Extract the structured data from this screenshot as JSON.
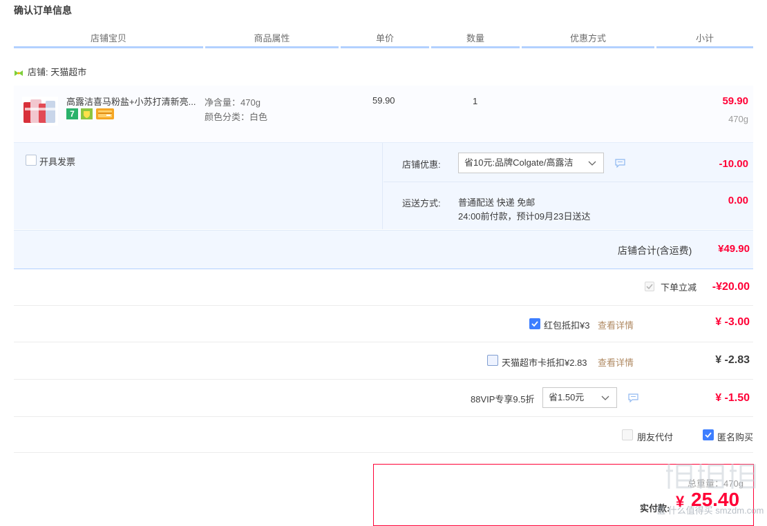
{
  "page_title": "确认订单信息",
  "columns": [
    "店铺宝贝",
    "商品属性",
    "单价",
    "数量",
    "优惠方式",
    "小计"
  ],
  "shop": {
    "label": "店铺: 天猫超市"
  },
  "item": {
    "name": "高露洁喜马粉盐+小苏打清新亮...",
    "attr_weight": "净含量：470g",
    "attr_color": "颜色分类：白色",
    "unit_price": "59.90",
    "quantity": "1",
    "subtotal": "59.90",
    "subtotal_note": "470g",
    "badge_7_label": "7"
  },
  "invoice": {
    "label": "开具发票",
    "checked": false
  },
  "shop_discount": {
    "label": "店铺优惠:",
    "selected": "省10元:品牌Colgate/高露洁",
    "amount": "-10.00"
  },
  "shipping": {
    "label": "运送方式:",
    "method": "普通配送 快递 免邮",
    "note": "24:00前付款，预计09月23日送达",
    "amount": "0.00"
  },
  "shop_total": {
    "label": "店铺合计(含运费)",
    "amount": "¥49.90"
  },
  "instant_discount": {
    "label": "下单立减",
    "amount": "-¥20.00",
    "checked": true
  },
  "red_packet": {
    "label": "红包抵扣¥3",
    "link": "查看详情",
    "amount": "¥ -3.00",
    "checked": true
  },
  "tmall_card": {
    "label": "天猫超市卡抵扣¥2.83",
    "link": "查看详情",
    "amount": "¥ -2.83",
    "checked": false
  },
  "vip": {
    "label": "88VIP专享9.5折",
    "selected": "省1.50元",
    "amount": "¥ -1.50"
  },
  "friend_pay": {
    "label": "朋友代付",
    "checked": false
  },
  "anonymous": {
    "label": "匿名购买",
    "checked": true
  },
  "pay": {
    "label": "实付款:",
    "currency": "¥",
    "amount": "25.40",
    "weight_label": "总重量：470g"
  },
  "watermark": "值 什么值得买 smzdm.com",
  "colors": {
    "accent": "#ff0036",
    "primary": "#3d7eff",
    "header_line": "#b2d1ff",
    "option_bg": "#f2f7ff",
    "link": "#b08a63"
  }
}
